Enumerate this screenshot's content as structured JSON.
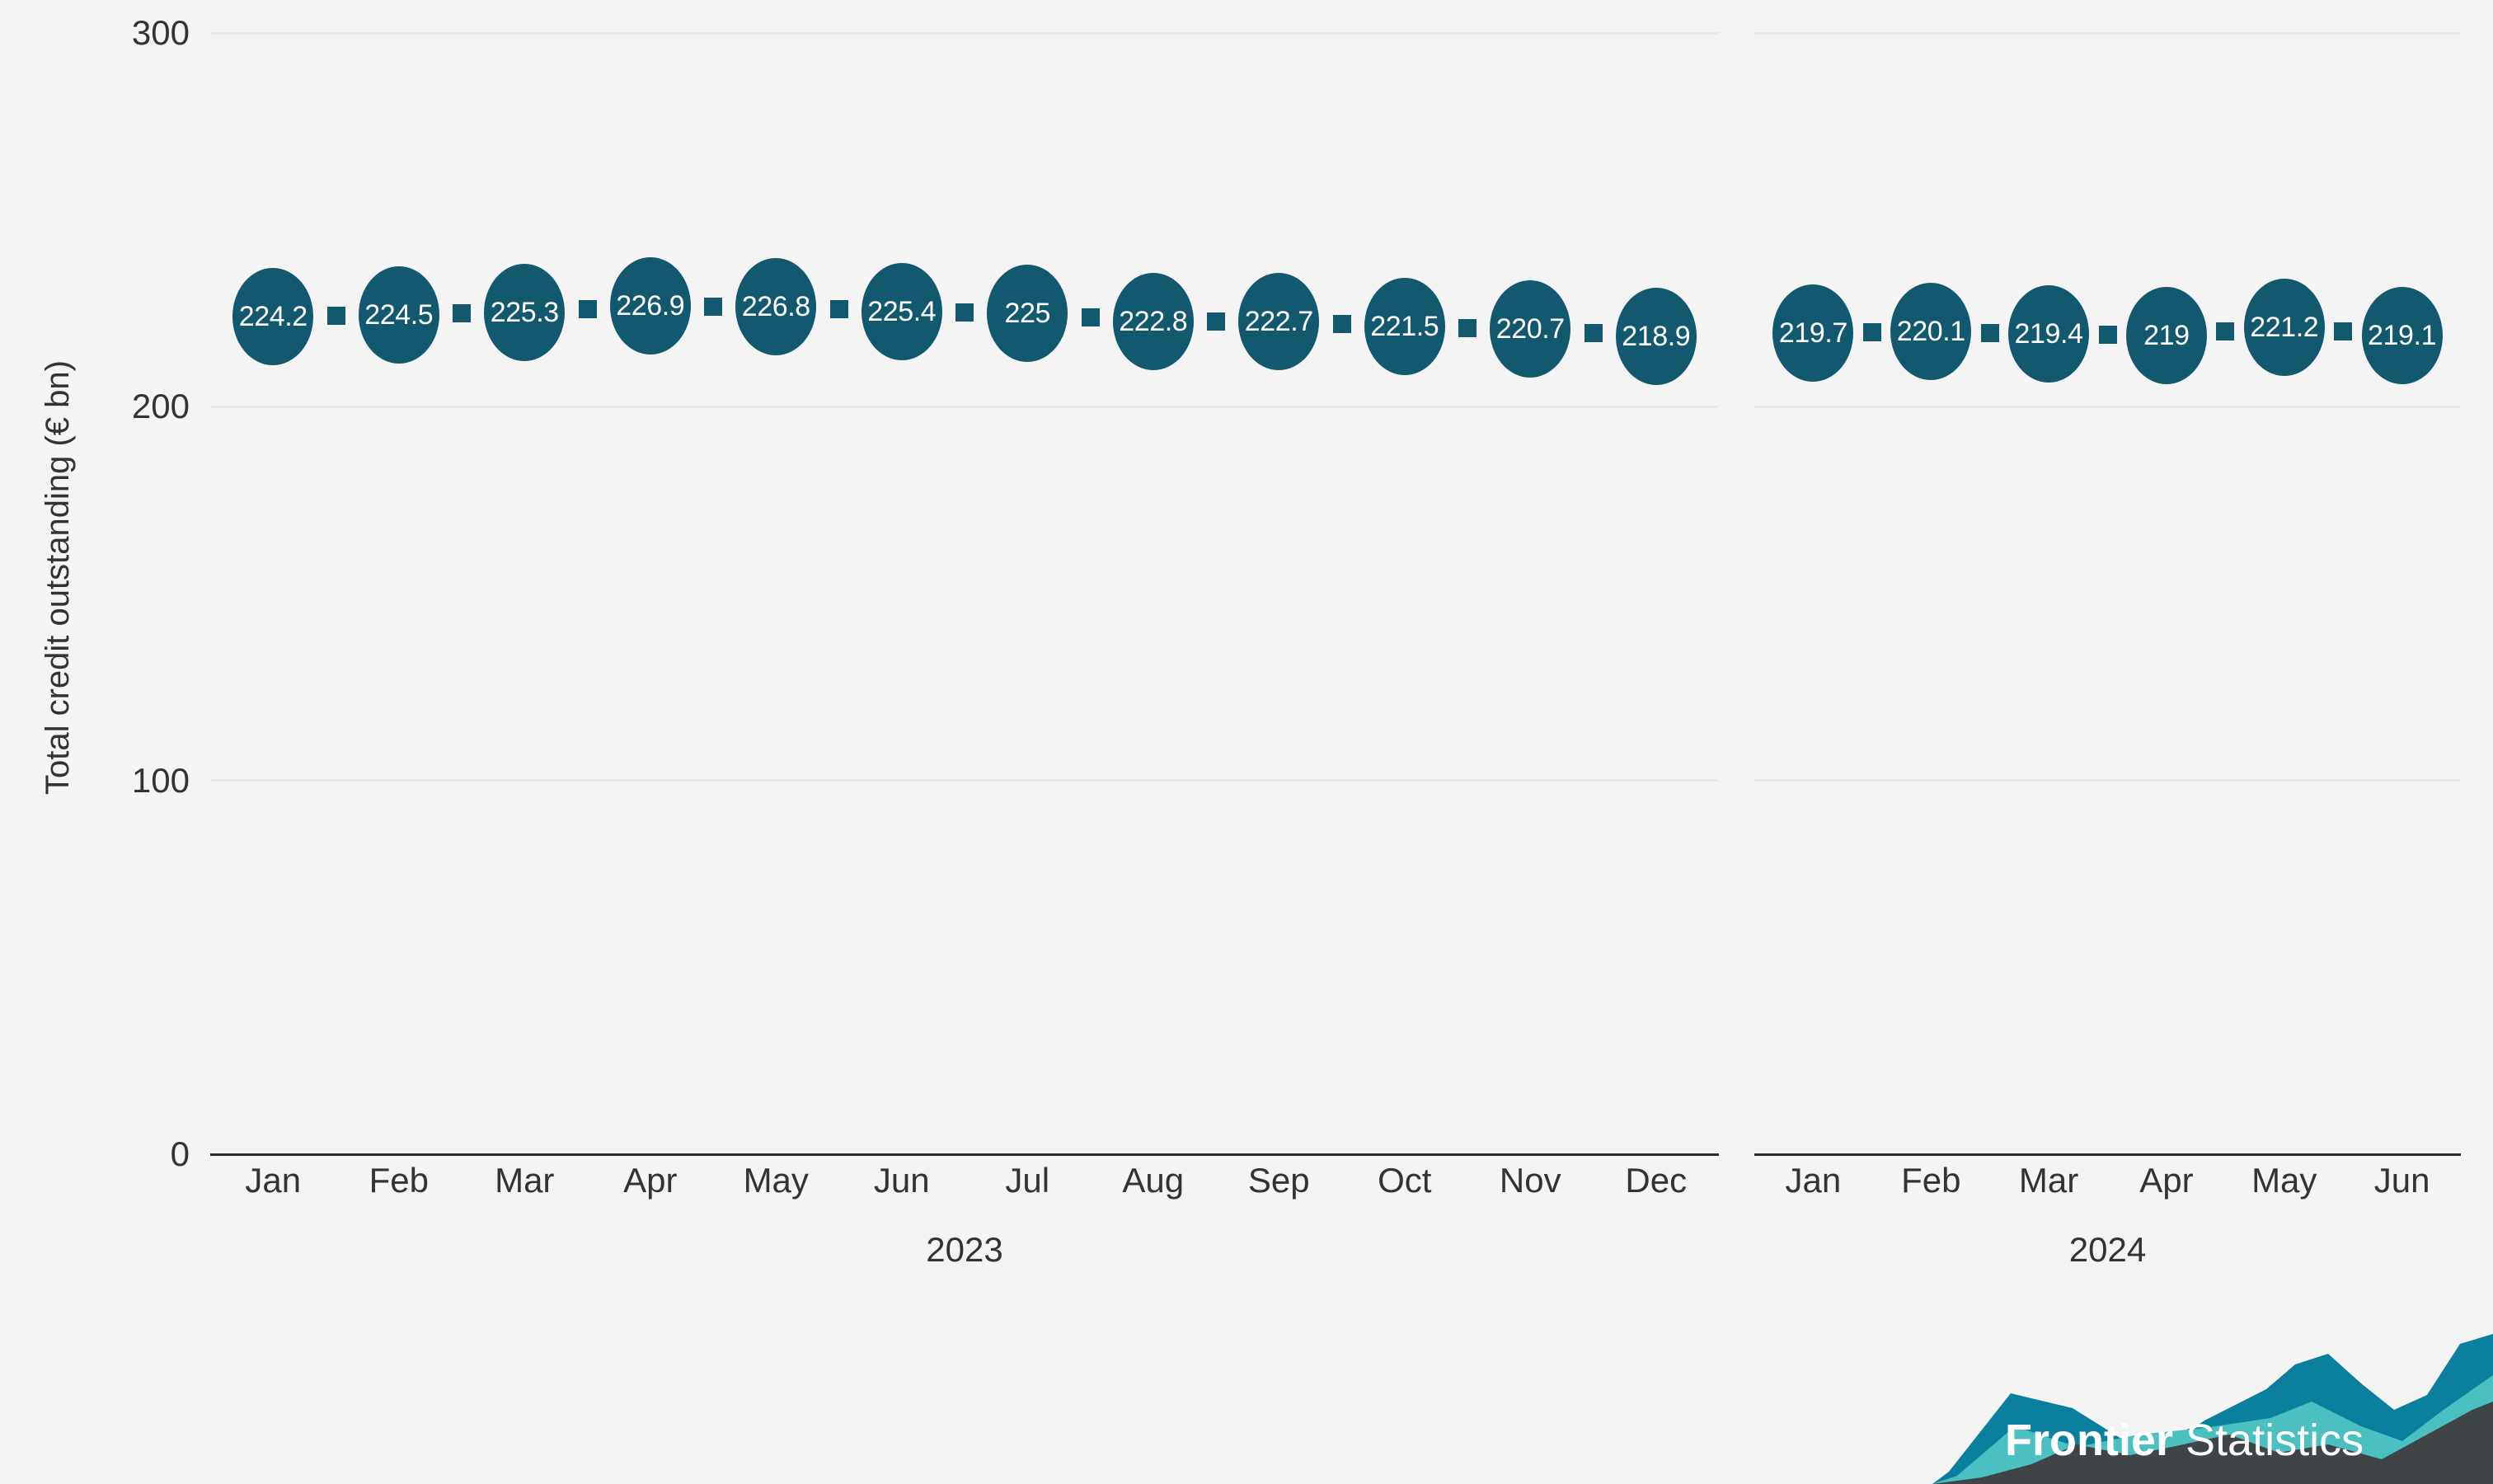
{
  "chart_data": {
    "type": "scatter",
    "title": "",
    "subtitle": "",
    "xlabel": "",
    "ylabel": "Total credit outstanding (€ bn)",
    "ylim": [
      0,
      300
    ],
    "yticks": [
      "0",
      "100",
      "200",
      "300"
    ],
    "ytick_values": [
      0,
      100,
      200,
      300
    ],
    "grid": true,
    "legend": "none",
    "panels": [
      {
        "year": "2023",
        "categories": [
          "Jan",
          "Feb",
          "Mar",
          "Apr",
          "May",
          "Jun",
          "Jul",
          "Aug",
          "Sep",
          "Oct",
          "Nov",
          "Dec"
        ],
        "values": [
          224.2,
          224.5,
          225.3,
          226.9,
          226.8,
          225.4,
          225,
          222.8,
          222.7,
          221.5,
          220.7,
          218.9
        ],
        "labels": [
          "224.2",
          "224.5",
          "225.3",
          "226.9",
          "226.8",
          "225.4",
          "225",
          "222.8",
          "222.7",
          "221.5",
          "220.7",
          "218.9"
        ]
      },
      {
        "year": "2024",
        "categories": [
          "Jan",
          "Feb",
          "Mar",
          "Apr",
          "May",
          "Jun"
        ],
        "values": [
          219.7,
          220.1,
          219.4,
          219,
          221.2,
          219.1
        ],
        "labels": [
          "219.7",
          "220.1",
          "219.4",
          "219",
          "221.2",
          "219.1"
        ]
      }
    ],
    "colors": {
      "marker": "#12596f",
      "marker_label": "#ffffff",
      "background": "#f4f4f4",
      "gridline": "#e9e9e9",
      "axis": "#2b2b2b",
      "text": "#333333"
    }
  },
  "logo": {
    "name": "frontier-statistics-logo",
    "bold_text": "Frontier",
    "light_text": "Statistics",
    "colors": {
      "dark_teal": "#0b7f9e",
      "light_teal": "#4cc0c0",
      "charcoal": "#3f4447"
    }
  }
}
